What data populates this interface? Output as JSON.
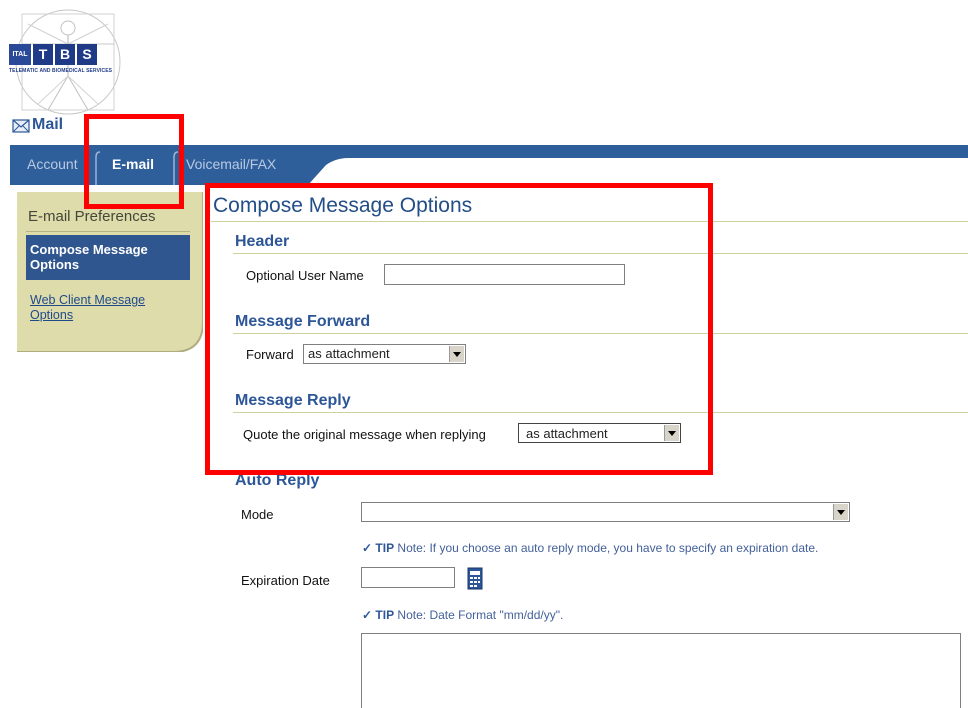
{
  "logo": {
    "ital": "ITAL",
    "letters": [
      "T",
      "B",
      "S"
    ],
    "subtitle": "TELEMATIC AND BIOMEDICAL SERVICES"
  },
  "app": {
    "title": "Mail"
  },
  "tabs": [
    {
      "label": "Account",
      "active": false
    },
    {
      "label": "E-mail",
      "active": true
    },
    {
      "label": "Voicemail/FAX",
      "active": false
    }
  ],
  "sidebar": {
    "heading": "E-mail Preferences",
    "items": [
      {
        "label": "Compose Message Options",
        "active": true
      },
      {
        "label": "Web Client Message Options",
        "active": false
      }
    ]
  },
  "page": {
    "title": "Compose Message Options",
    "header": {
      "title": "Header",
      "user_name_label": "Optional User Name",
      "user_name_value": ""
    },
    "forward": {
      "title": "Message Forward",
      "label": "Forward",
      "value": "as attachment"
    },
    "reply": {
      "title": "Message Reply",
      "label": "Quote the original message when replying",
      "value": "as attachment"
    },
    "auto_reply": {
      "title": "Auto Reply",
      "mode_label": "Mode",
      "mode_value": "",
      "tip_word": "TIP",
      "mode_tip": "Note: If you choose an auto reply mode, you have to specify an expiration date.",
      "expiration_label": "Expiration Date",
      "expiration_value": "",
      "date_tip": "Note: Date Format \"mm/dd/yy\"."
    }
  },
  "colors": {
    "tabbar": "#2f5f9a",
    "sidebar_bg": "#dedcab",
    "sidebar_active": "#2f568f",
    "annotation": "#ff0000"
  }
}
